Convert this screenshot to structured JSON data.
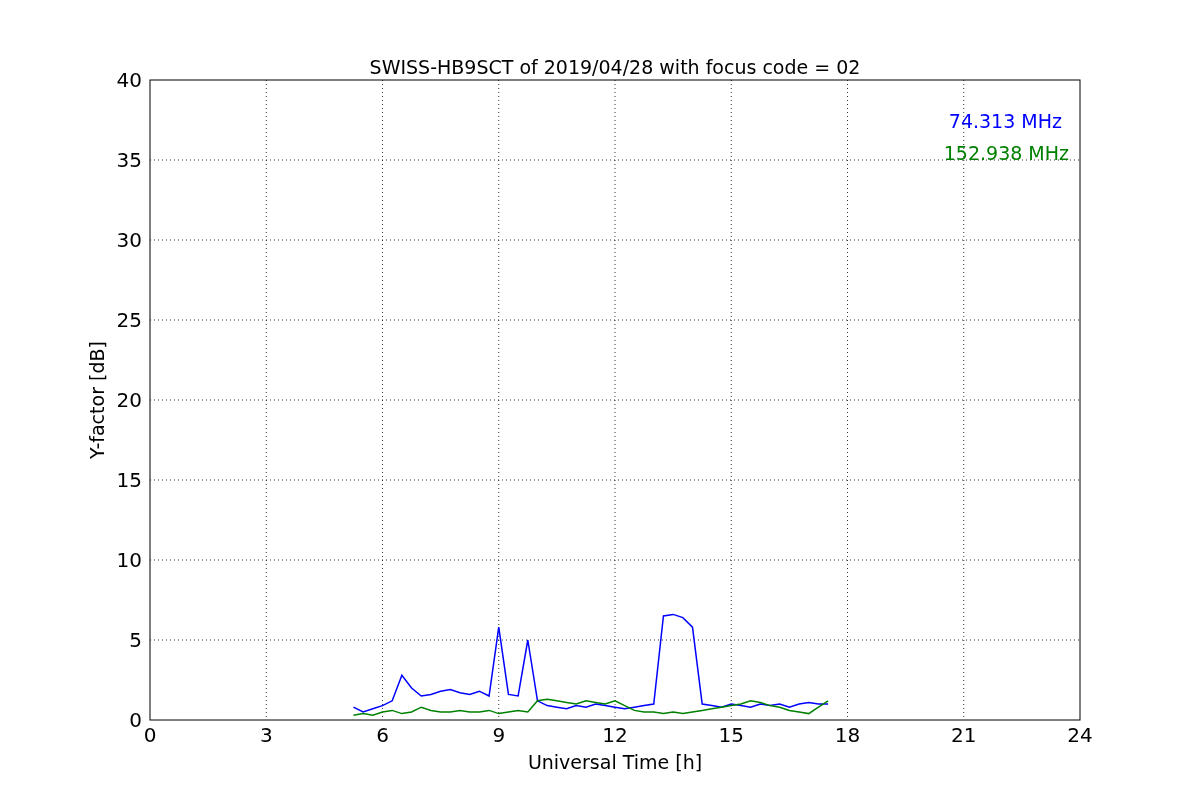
{
  "chart_data": {
    "type": "line",
    "title": "SWISS-HB9SCT of 2019/04/28 with focus code = 02",
    "xlabel": "Universal Time [h]",
    "ylabel": "Y-factor [dB]",
    "x": [
      5.25,
      5.5,
      5.75,
      6,
      6.25,
      6.5,
      6.75,
      7,
      7.25,
      7.5,
      7.75,
      8,
      8.25,
      8.5,
      8.75,
      9,
      9.25,
      9.5,
      9.75,
      10,
      10.25,
      10.5,
      10.75,
      11,
      11.25,
      11.5,
      11.75,
      12,
      12.25,
      12.5,
      12.75,
      13,
      13.25,
      13.5,
      13.75,
      14,
      14.25,
      14.5,
      14.75,
      15,
      15.25,
      15.5,
      15.75,
      16,
      16.25,
      16.5,
      16.75,
      17,
      17.25,
      17.5
    ],
    "series": [
      {
        "name": "74.313 MHz",
        "color": "#0000ff",
        "values": [
          0.8,
          0.5,
          0.7,
          0.9,
          1.2,
          2.8,
          2.0,
          1.5,
          1.6,
          1.8,
          1.9,
          1.7,
          1.6,
          1.8,
          1.5,
          5.8,
          1.6,
          1.5,
          5.0,
          1.2,
          0.9,
          0.8,
          0.7,
          0.9,
          0.8,
          1.0,
          0.9,
          0.8,
          0.7,
          0.8,
          0.9,
          1.0,
          6.5,
          6.6,
          6.4,
          5.8,
          1.0,
          0.9,
          0.8,
          1.0,
          0.9,
          0.8,
          1.0,
          0.9,
          1.0,
          0.8,
          1.0,
          1.1,
          1.0,
          1.0
        ]
      },
      {
        "name": "152.938 MHz",
        "color": "#008000",
        "values": [
          0.3,
          0.4,
          0.3,
          0.5,
          0.6,
          0.4,
          0.5,
          0.8,
          0.6,
          0.5,
          0.5,
          0.6,
          0.5,
          0.5,
          0.6,
          0.4,
          0.5,
          0.6,
          0.5,
          1.2,
          1.3,
          1.2,
          1.1,
          1.0,
          1.2,
          1.1,
          1.0,
          1.2,
          0.9,
          0.6,
          0.5,
          0.5,
          0.4,
          0.5,
          0.4,
          0.5,
          0.6,
          0.7,
          0.8,
          0.9,
          1.0,
          1.2,
          1.1,
          0.9,
          0.8,
          0.6,
          0.5,
          0.4,
          0.8,
          1.2
        ]
      }
    ],
    "xlim": [
      0,
      24
    ],
    "ylim": [
      0,
      40
    ],
    "xticks": [
      0,
      3,
      6,
      9,
      12,
      15,
      18,
      21,
      24
    ],
    "yticks": [
      0,
      5,
      10,
      15,
      20,
      25,
      30,
      35,
      40
    ],
    "grid": true
  }
}
